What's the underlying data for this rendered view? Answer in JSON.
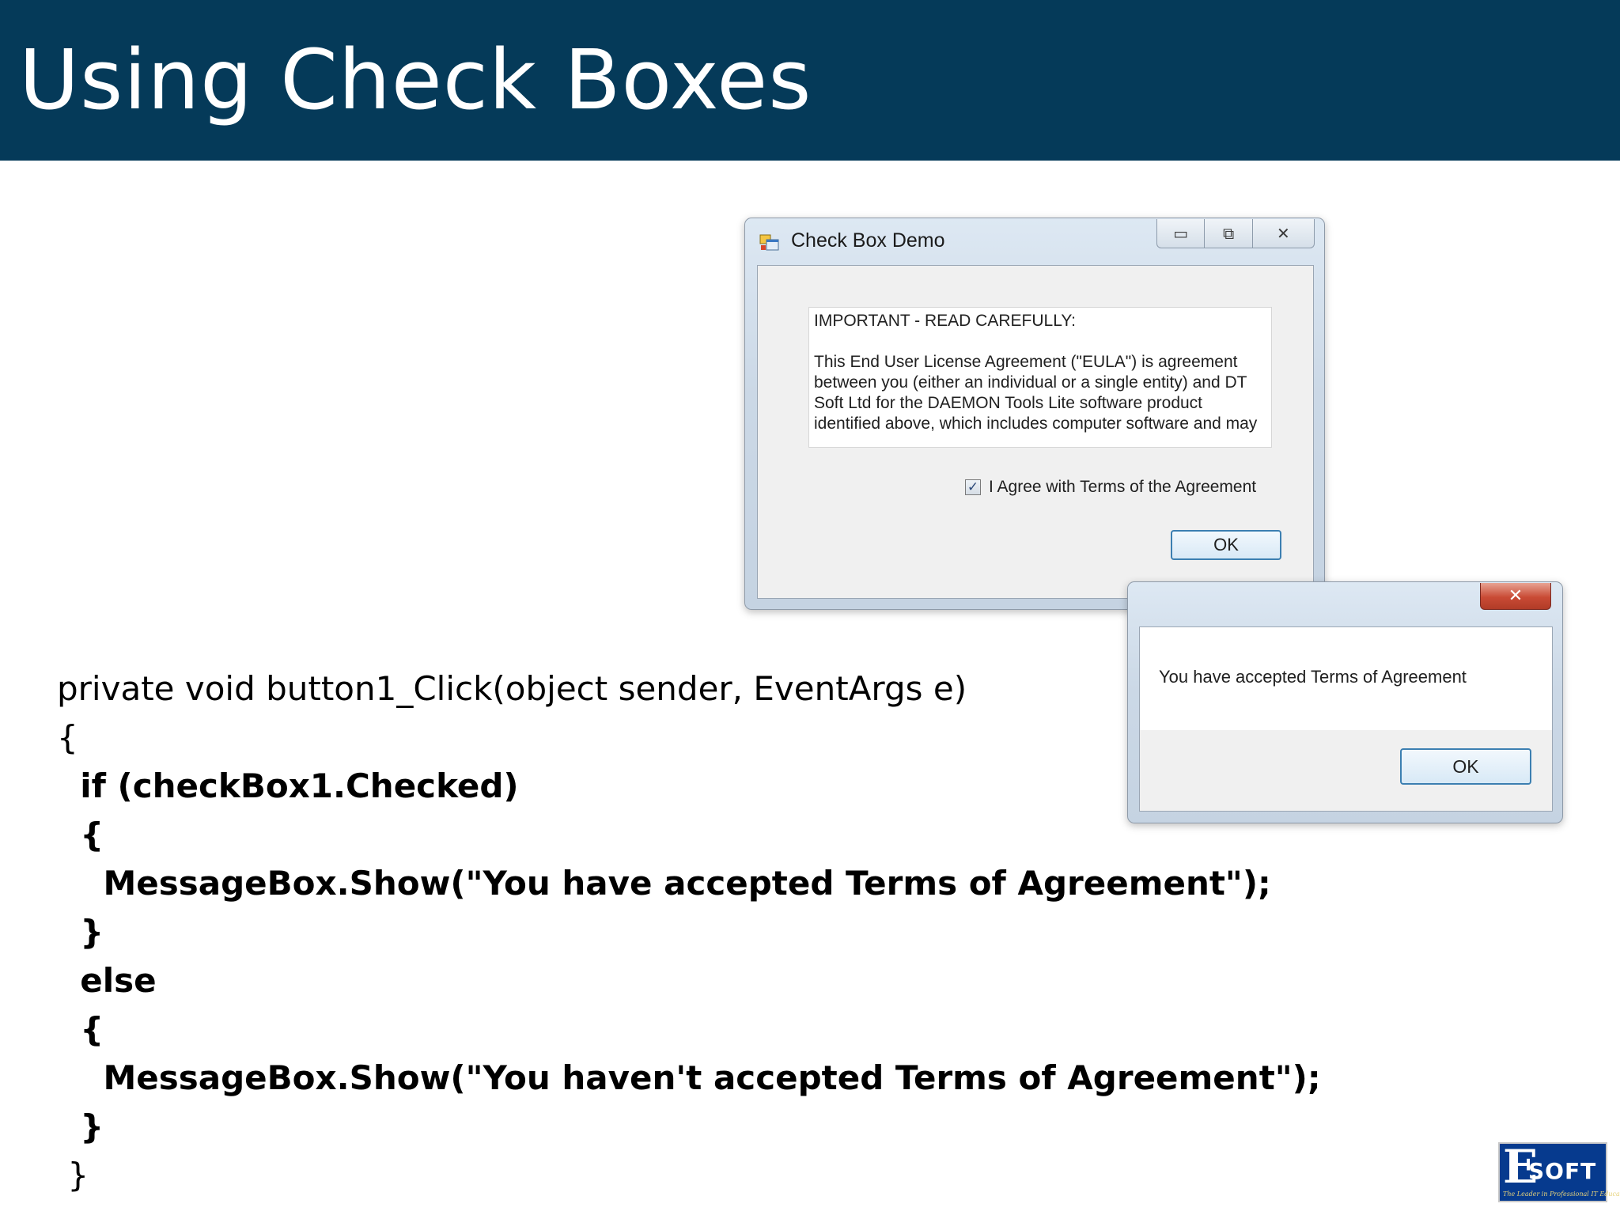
{
  "slide": {
    "title": "Using Check Boxes"
  },
  "dialog": {
    "title": "Check Box Demo",
    "controls": {
      "minimize": "▭",
      "maximize": "⧉",
      "close": "✕"
    },
    "eula_lines": [
      "IMPORTANT - READ CAREFULLY:",
      "",
      "This End User License Agreement (\"EULA\") is agreement",
      "between you (either an individual or a single entity) and DT",
      "Soft Ltd for the DAEMON Tools Lite software product",
      "identified above, which includes computer software and may"
    ],
    "checkbox_label": "I Agree with Terms of the Agreement",
    "checkbox_checked": true,
    "ok_label": "OK"
  },
  "message_box": {
    "close": "✕",
    "text": "You have accepted Terms of Agreement",
    "ok_label": "OK"
  },
  "code_lines": [
    {
      "text": "private void button1_Click(object sender, EventArgs e)",
      "bold": false
    },
    {
      "text": "{",
      "bold": false
    },
    {
      "text": "  if (checkBox1.Checked)",
      "bold": true
    },
    {
      "text": "  {",
      "bold": true
    },
    {
      "text": "    MessageBox.Show(\"You have accepted Terms of Agreement\");",
      "bold": true
    },
    {
      "text": "  }",
      "bold": true
    },
    {
      "text": "  else",
      "bold": true
    },
    {
      "text": "  {",
      "bold": true
    },
    {
      "text": "    MessageBox.Show(\"You haven't accepted Terms of Agreement\");",
      "bold": true
    },
    {
      "text": "  }",
      "bold": true
    },
    {
      "text": " }",
      "bold": false
    }
  ],
  "logo": {
    "letter": "E",
    "word": "SOFT",
    "tagline": "The Leader in Professional IT Education"
  },
  "colors": {
    "header": "#053a59",
    "logo": "#063a8e",
    "close_red": "#c94b35"
  }
}
